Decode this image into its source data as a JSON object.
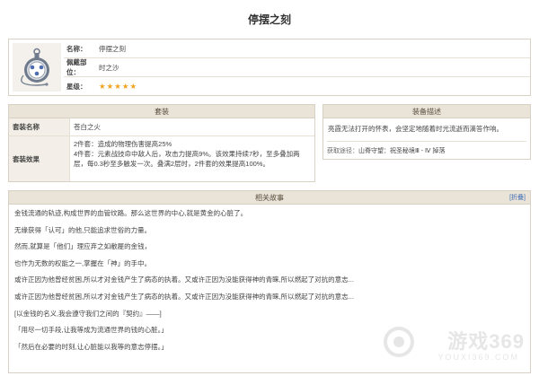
{
  "page": {
    "title": "停摆之刻"
  },
  "info": {
    "icon": "artifact-pocket-watch-icon",
    "rows": [
      {
        "label": "名称：",
        "value": "停摆之刻"
      },
      {
        "label": "佩戴部位：",
        "value": "时之沙"
      },
      {
        "label": "星级：",
        "stars": 5
      }
    ]
  },
  "set": {
    "header": "套装",
    "name_label": "套装名称",
    "name_value": "苍白之火",
    "effect_label": "套装效果",
    "effect_line1": "2件套：造成的物理伤害提高25%",
    "effect_line2": "4件套：元素战技命中敌人后，攻击力提高9%。该效果持续7秒，至多叠加两",
    "effect_line3": "层，每0.3秒至多触发一次。叠满2层时，2件套的效果提高100%。"
  },
  "equip": {
    "header": "装备描述",
    "desc": "亮霞无法打开的怀表，会坚定地随着时光流逝而滴答作响。",
    "source_label": "获取途径：",
    "source_value": "山脊守望：祝圣秘境Ⅲ - Ⅳ 掉落"
  },
  "story": {
    "header": "相关故事",
    "toggle": "[折叠]",
    "lines": [
      "金钱流通的轨迹,构成世界的血管纹路。那么这世界的中心,就是黄金的心脏了。",
      "无缘获得「认可」的他,只能追求世俗的力量。",
      "然而,就算是「他们」理应弃之如敝屣的金钱，",
      "也作为无数的权能之一,掌握在「神」的手中。",
      "或许正因为他曾经贫困,所以才对金钱产生了病态的执着。又或许正因为没能获得神的青睐,所以燃起了对抗的意志...",
      "或许正因为他曾经贫困,所以才对金钱产生了病态的执着。又或许正因为没能获得神的青睐,所以燃起了对抗的意志...",
      "[以金钱的名义,我会遵守我们之间的『契约』——]",
      "「用尽一切手段,让我等成为流通世界的钱的心脏。」",
      "「然后在必要的时刻,让心脏能以我等的意志停摆。」"
    ]
  },
  "watermark": {
    "brand": "游戏369",
    "url": "YOUXI369.COM"
  },
  "colors": {
    "accent": "#f0a21b",
    "header_bg": "#e9e3d8",
    "border": "#d9d2c4",
    "link": "#3f6db5"
  }
}
